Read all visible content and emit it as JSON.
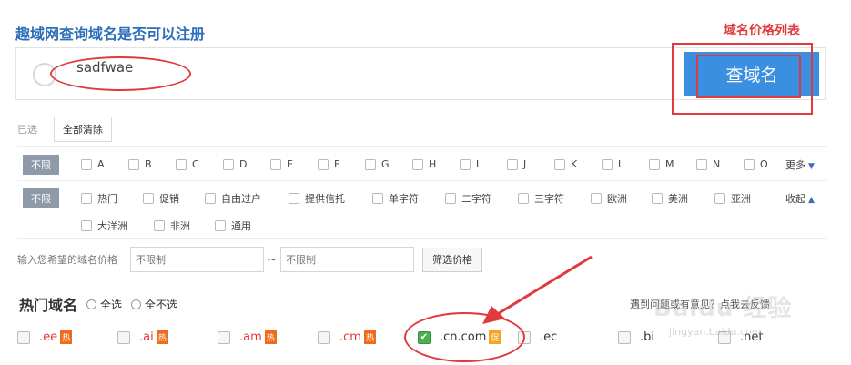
{
  "page_title": "趣域网查询域名是否可以注册",
  "annotation_label": "域名价格列表",
  "search": {
    "value": "sadfwae",
    "button": "查域名"
  },
  "selected": {
    "label": "已选",
    "clear_button": "全部清除"
  },
  "letter_filter": {
    "tag": "不限",
    "options": [
      "A",
      "B",
      "C",
      "D",
      "E",
      "F",
      "G",
      "H",
      "I",
      "J",
      "K",
      "L",
      "M",
      "N",
      "O"
    ],
    "more": "更多"
  },
  "category_filter": {
    "tag": "不限",
    "options": [
      "热门",
      "促销",
      "自由过户",
      "提供信托",
      "单字符",
      "二字符",
      "三字符",
      "欧洲",
      "美洲",
      "亚洲",
      "大洋洲",
      "非洲",
      "通用"
    ],
    "collapse": "收起"
  },
  "price_filter": {
    "label": "输入您希望的域名价格",
    "min_placeholder": "不限制",
    "separator": "~",
    "max_placeholder": "不限制",
    "button": "筛选价格"
  },
  "hot_domains": {
    "title": "热门域名",
    "select_all": "全选",
    "select_none": "全不选",
    "feedback": "遇到问题或有意见？点我去反馈",
    "items": [
      {
        "name": ".ee",
        "badge": "热",
        "checked": false
      },
      {
        "name": ".ai",
        "badge": "热",
        "checked": false
      },
      {
        "name": ".am",
        "badge": "热",
        "checked": false
      },
      {
        "name": ".cm",
        "badge": "热",
        "checked": false
      },
      {
        "name": ".cn.com",
        "badge": "促",
        "checked": true
      },
      {
        "name": ".ec",
        "badge": "",
        "checked": false
      },
      {
        "name": ".bi",
        "badge": "",
        "checked": false
      },
      {
        "name": ".net",
        "badge": "",
        "checked": false
      }
    ]
  },
  "watermark": {
    "main": "Baidu 经验",
    "sub": "jingyan.baidu.com"
  },
  "colors": {
    "accent": "#3b8fe0",
    "annotation": "#e0393e",
    "hot_badge": "#ef6c1d",
    "title": "#2c6fb8"
  }
}
